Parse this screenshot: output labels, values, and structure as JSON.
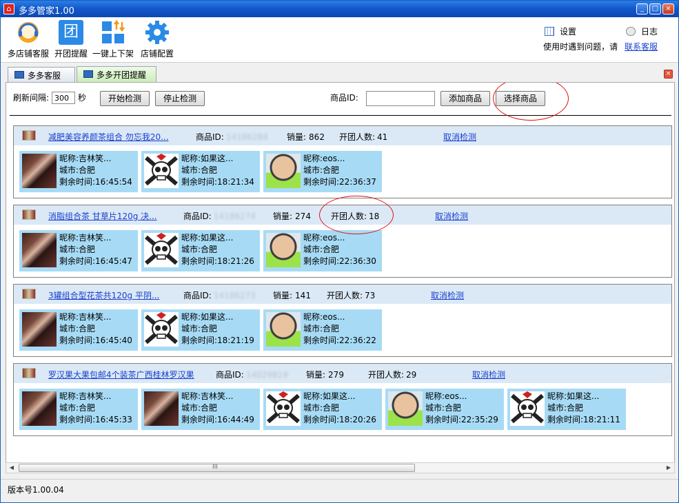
{
  "window": {
    "title": "多多管家1.00",
    "app_icon": "home-icon",
    "min": "_",
    "max": "□",
    "close": "×"
  },
  "toolbar": {
    "items": [
      {
        "label": "多店铺客服",
        "icon": "headset-icon"
      },
      {
        "label": "开团提醒",
        "icon": "group-icon",
        "glyph": "团"
      },
      {
        "label": "一键上下架",
        "icon": "grid-arrows-icon"
      },
      {
        "label": "店铺配置",
        "icon": "gear-icon"
      }
    ],
    "settings_label": "设置",
    "log_label": "日志",
    "help_text": "使用时遇到问题，请",
    "contact_link": "联系客服"
  },
  "tabs": [
    {
      "label": "多多客服",
      "active": false
    },
    {
      "label": "多多开团提醒",
      "active": true
    }
  ],
  "controls": {
    "interval_label": "刷新间隔:",
    "interval_value": "300",
    "seconds_label": "秒",
    "start_label": "开始检测",
    "stop_label": "停止检测",
    "product_id_label": "商品ID:",
    "product_id_value": "",
    "add_label": "添加商品",
    "select_label": "选择商品"
  },
  "labels": {
    "product_id": "商品ID:",
    "sales": "销量:",
    "group_count": "开团人数:",
    "cancel": "取消检测",
    "nick": "昵称:",
    "city": "城市:",
    "remaining": "剩余时间:"
  },
  "groups": [
    {
      "name": "减肥美容养颜茶组合 勿忘我20...",
      "product_id": "14186284",
      "sales": "862",
      "group_count": "41",
      "members": [
        {
          "avatar": "girl-avatar",
          "nick": "吉林笑...",
          "city": "合肥",
          "remaining": "16:45:54"
        },
        {
          "avatar": "skull-avatar",
          "nick": "如果这...",
          "city": "合肥",
          "remaining": "18:21:34"
        },
        {
          "avatar": "man-avatar",
          "nick": "eos...",
          "city": "合肥",
          "remaining": "22:36:37"
        }
      ]
    },
    {
      "name": "消脂组合茶 甘草片120g 决...",
      "product_id": "14186274",
      "sales": "274",
      "group_count": "18",
      "members": [
        {
          "avatar": "girl-avatar",
          "nick": "吉林笑...",
          "city": "合肥",
          "remaining": "16:45:47"
        },
        {
          "avatar": "skull-avatar",
          "nick": "如果这...",
          "city": "合肥",
          "remaining": "18:21:26"
        },
        {
          "avatar": "man-avatar",
          "nick": "eos...",
          "city": "合肥",
          "remaining": "22:36:30"
        }
      ]
    },
    {
      "name": "3罐组合型花茶共120g 平阴...",
      "product_id": "14186273",
      "sales": "141",
      "group_count": "73",
      "members": [
        {
          "avatar": "girl-avatar",
          "nick": "吉林笑...",
          "city": "合肥",
          "remaining": "16:45:40"
        },
        {
          "avatar": "skull-avatar",
          "nick": "如果这...",
          "city": "合肥",
          "remaining": "18:21:19"
        },
        {
          "avatar": "man-avatar",
          "nick": "eos...",
          "city": "合肥",
          "remaining": "22:36:22"
        }
      ]
    },
    {
      "name": "罗汉果大果包邮4个装茶广西桂林罗汉果",
      "product_id": "14029819",
      "sales": "279",
      "group_count": "29",
      "members": [
        {
          "avatar": "girl-avatar",
          "nick": "吉林笑...",
          "city": "合肥",
          "remaining": "16:45:33"
        },
        {
          "avatar": "girl-avatar",
          "nick": "吉林笑...",
          "city": "合肥",
          "remaining": "16:44:49"
        },
        {
          "avatar": "skull-avatar",
          "nick": "如果这...",
          "city": "合肥",
          "remaining": "18:20:26"
        },
        {
          "avatar": "man-avatar",
          "nick": "eos...",
          "city": "合肥",
          "remaining": "22:35:29"
        },
        {
          "avatar": "skull-avatar",
          "nick": "如果这...",
          "city": "合肥",
          "remaining": "18:21:11"
        }
      ]
    }
  ],
  "scrollbar": {
    "thumb_glyph": "III",
    "left_arrow": "◀",
    "right_arrow": "▶"
  },
  "status": {
    "version": "版本号1.00.04"
  },
  "colors": {
    "title_bar": "#1257c9",
    "row_header": "#dbe9f6",
    "member_card": "#a7dbf5",
    "link": "#1a3fcf",
    "annotation": "#e01010"
  }
}
